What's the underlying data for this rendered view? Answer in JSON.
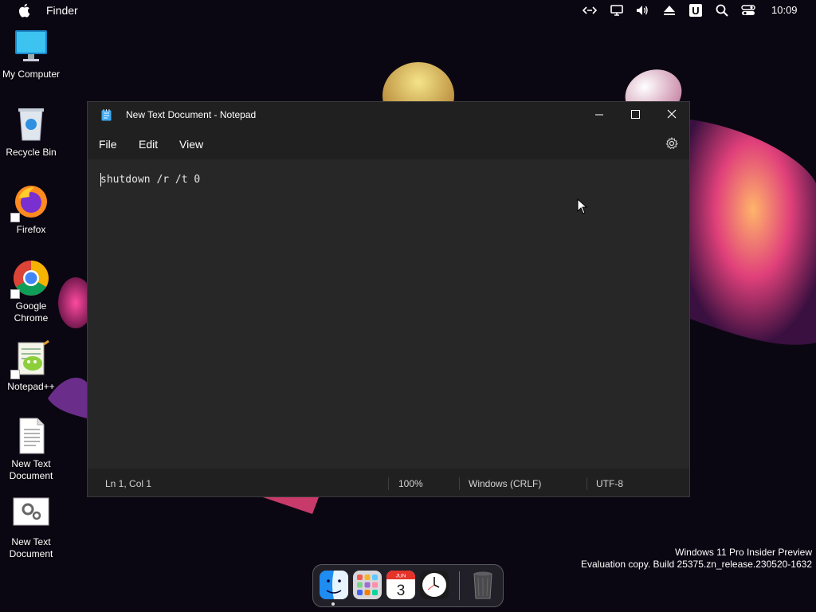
{
  "menubar": {
    "app_name": "Finder",
    "clock": "10:09",
    "icons": [
      "apple-icon",
      "code-arrows-icon",
      "display-icon",
      "volume-icon",
      "eject-icon",
      "u-badge-icon",
      "search-icon",
      "control-center-icon"
    ]
  },
  "desktop": {
    "icons": [
      {
        "label": "My Computer",
        "icon": "monitor-icon"
      },
      {
        "label": "Recycle Bin",
        "icon": "recycle-bin-icon"
      },
      {
        "label": "Firefox",
        "icon": "firefox-icon"
      },
      {
        "label": "Google Chrome",
        "icon": "chrome-icon"
      },
      {
        "label": "Notepad++",
        "icon": "notepadpp-icon"
      },
      {
        "label": "New Text Document",
        "icon": "text-document-icon"
      },
      {
        "label": "New Text Document",
        "icon": "settings-document-icon"
      }
    ]
  },
  "notepad": {
    "title": "New Text Document - Notepad",
    "menu": [
      "File",
      "Edit",
      "View"
    ],
    "content": "shutdown /r /t 0",
    "status": {
      "position": "Ln 1, Col 1",
      "zoom": "100%",
      "line_ending": "Windows (CRLF)",
      "encoding": "UTF-8"
    }
  },
  "watermark": {
    "line1": "Windows 11 Pro Insider Preview",
    "line2": "Evaluation copy. Build 25375.zn_release.230520-1632"
  },
  "dock": {
    "items": [
      "finder-icon",
      "launchpad-icon",
      "calendar-icon",
      "clock-icon",
      "trash-icon"
    ],
    "calendar_month": "JUN",
    "calendar_day": "3"
  },
  "colors": {
    "window_bg": "#202020",
    "editor_bg": "#272727",
    "desktop_bg": "#0b0712"
  }
}
